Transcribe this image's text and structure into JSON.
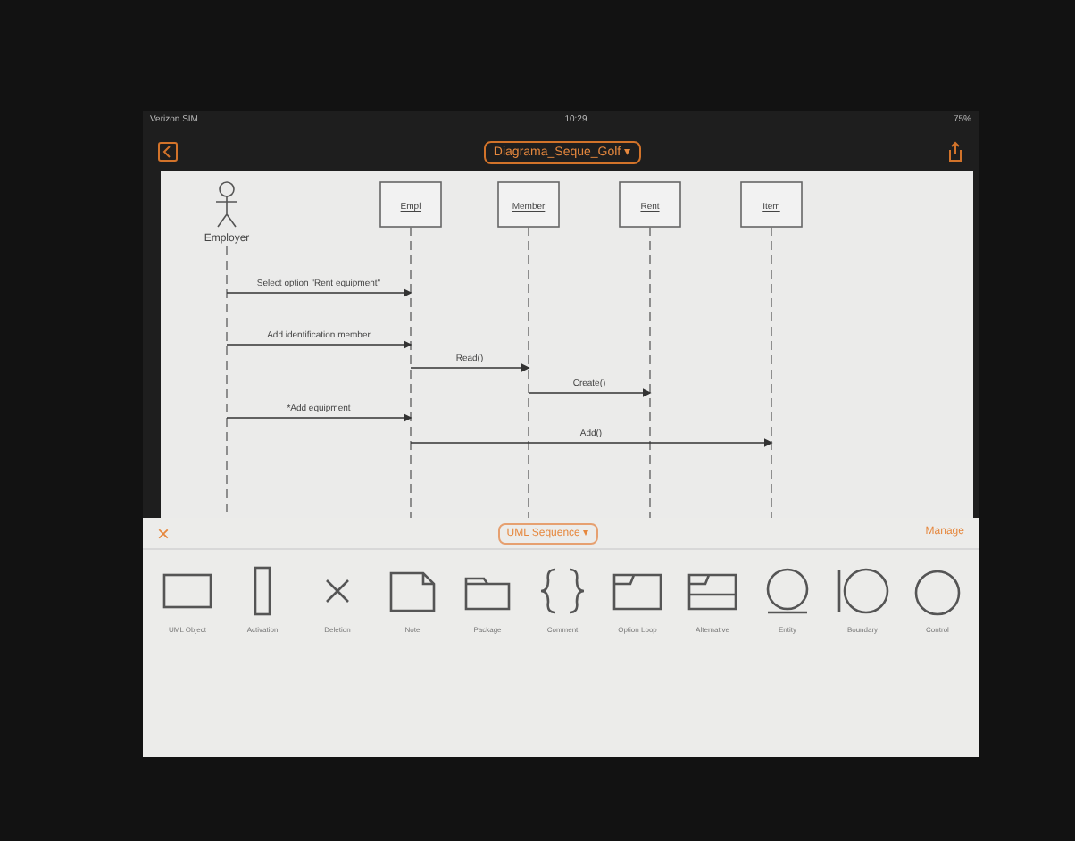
{
  "status_bar": {
    "carrier": "Verizon SIM",
    "time": "10:29",
    "battery": "75%"
  },
  "toolbar": {
    "title": "Diagrama_Seque_Golf ▾"
  },
  "diagram": {
    "actor": "Employer",
    "lifelines": [
      "Empl",
      "Member",
      "Rent",
      "Item"
    ],
    "messages": [
      "Select option \"Rent equipment\"",
      "Add identification member",
      "Read()",
      "Create()",
      "*Add equipment",
      "Add()"
    ]
  },
  "palette": {
    "close": "×",
    "category": "UML Sequence ▾",
    "manage": "Manage",
    "items": [
      {
        "kind": "rect",
        "label": "UML Object"
      },
      {
        "kind": "bar",
        "label": "Activation"
      },
      {
        "kind": "cross",
        "label": "Deletion"
      },
      {
        "kind": "note",
        "label": "Note"
      },
      {
        "kind": "folder",
        "label": "Package"
      },
      {
        "kind": "braces",
        "label": "Comment"
      },
      {
        "kind": "frame",
        "label": "Option Loop"
      },
      {
        "kind": "alt",
        "label": "Alternative"
      },
      {
        "kind": "entity",
        "label": "Entity"
      },
      {
        "kind": "boundary",
        "label": "Boundary"
      },
      {
        "kind": "control",
        "label": "Control"
      }
    ]
  }
}
